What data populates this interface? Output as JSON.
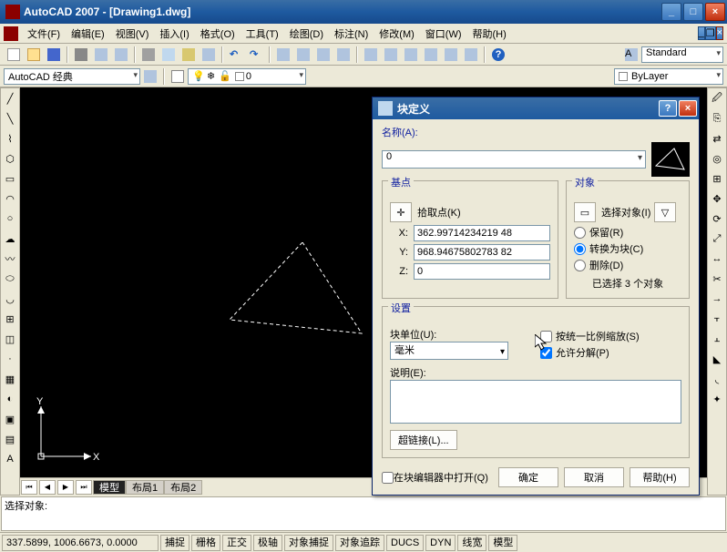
{
  "window": {
    "title": "AutoCAD 2007 - [Drawing1.dwg]"
  },
  "menu": {
    "items": [
      "文件(F)",
      "编辑(E)",
      "视图(V)",
      "插入(I)",
      "格式(O)",
      "工具(T)",
      "绘图(D)",
      "标注(N)",
      "修改(M)",
      "窗口(W)",
      "帮助(H)"
    ]
  },
  "toolbar2": {
    "style_combo": "Standard",
    "workspace": "AutoCAD 经典",
    "layer_combo": "0",
    "prop_combo": "ByLayer"
  },
  "tabs": {
    "model": "模型",
    "layout1": "布局1",
    "layout2": "布局2"
  },
  "command": {
    "line1": "选择对象:"
  },
  "status": {
    "coords": "337.5899, 1006.6673, 0.0000",
    "cells": [
      "捕捉",
      "栅格",
      "正交",
      "极轴",
      "对象捕捉",
      "对象追踪",
      "DUCS",
      "DYN",
      "线宽",
      "模型"
    ]
  },
  "dialog": {
    "title": "块定义",
    "name_label": "名称(A):",
    "name_value": "0",
    "base": {
      "legend": "基点",
      "pick": "拾取点(K)",
      "x_label": "X:",
      "x": "362.99714234219 48",
      "y_label": "Y:",
      "y": "968.94675802783 82",
      "z_label": "Z:",
      "z": "0"
    },
    "objects": {
      "legend": "对象",
      "select": "选择对象(I)",
      "retain": "保留(R)",
      "convert": "转换为块(C)",
      "delete": "删除(D)",
      "count": "已选择 3 个对象"
    },
    "settings": {
      "legend": "设置",
      "unit_label": "块单位(U):",
      "unit_value": "毫米",
      "scale_uniform": "按统一比例缩放(S)",
      "allow_explode": "允许分解(P)",
      "desc_label": "说明(E):",
      "hyperlink": "超链接(L)..."
    },
    "open_in_editor": "在块编辑器中打开(Q)",
    "buttons": {
      "ok": "确定",
      "cancel": "取消",
      "help": "帮助(H)"
    }
  }
}
